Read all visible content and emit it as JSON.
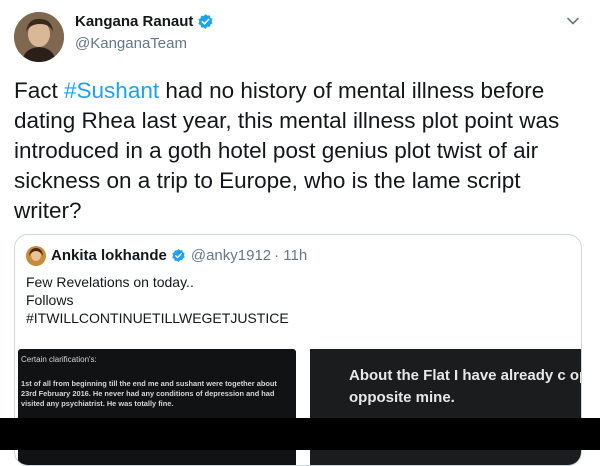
{
  "author": {
    "name": "Kangana Ranaut",
    "handle": "@KanganaTeam"
  },
  "tweet": {
    "pre": "Fact ",
    "hashtag": "#Sushant",
    "post": " had no history of mental illness before dating Rhea last year, this mental illness plot point was introduced in a goth hotel post genius plot twist of air sickness on a trip to Europe, who is the lame script writer?"
  },
  "quote": {
    "name": "Ankita lokhande",
    "handle": "@anky1912",
    "time": "· 11h",
    "lines": [
      "Few Revelations on today..",
      "Follows",
      "#ITWILLCONTINUETILLWEGETJUSTICE"
    ],
    "image_left": {
      "heading": "Certain clarification's:",
      "body": "1st of all from beginning till the end me and sushant were together about 23rd February 2016. He never had any conditions of depression and had visited any psychiatrist.  He was totally fine."
    },
    "image_right": {
      "text": "About the Flat I have already c opinion opposite mine."
    }
  },
  "colors": {
    "accent": "#1da1f2",
    "text": "#14171a",
    "muted": "#657786",
    "border": "#ccd6dd"
  },
  "icons": [
    "avatar-portrait",
    "verified-badge-icon",
    "chevron-down-icon"
  ]
}
